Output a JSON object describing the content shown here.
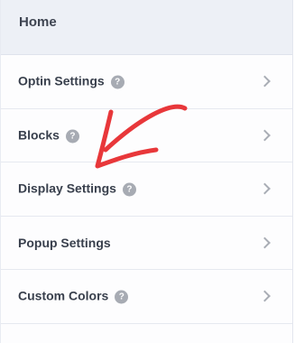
{
  "header": {
    "title": "Home"
  },
  "menu": {
    "items": [
      {
        "label": "Optin Settings",
        "help": "?"
      },
      {
        "label": "Blocks",
        "help": "?"
      },
      {
        "label": "Display Settings",
        "help": "?"
      },
      {
        "label": "Popup Settings"
      },
      {
        "label": "Custom Colors",
        "help": "?"
      }
    ]
  },
  "annotation": {
    "icon": "hand-drawn-arrow-icon",
    "color": "#e8373a"
  }
}
